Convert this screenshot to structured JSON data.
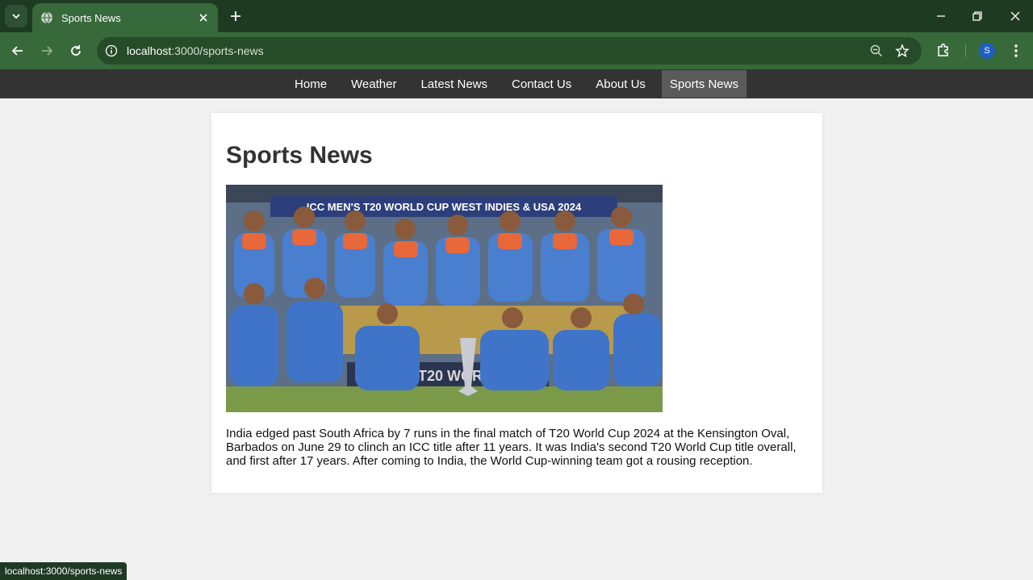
{
  "browser": {
    "tab_title": "Sports News",
    "url_host": "localhost",
    "url_path": ":3000/sports-news",
    "avatar_letter": "S",
    "status_url": "localhost:3000/sports-news",
    "colors": {
      "tabstrip": "#1f3a22",
      "toolbar": "#37693b",
      "omnibox": "#264b29"
    }
  },
  "nav": {
    "items": [
      {
        "label": "Home"
      },
      {
        "label": "Weather"
      },
      {
        "label": "Latest News"
      },
      {
        "label": "Contact Us"
      },
      {
        "label": "About Us"
      },
      {
        "label": "Sports News",
        "active": true
      }
    ]
  },
  "article": {
    "heading": "Sports News",
    "image_banner_text": "ICC MEN'S T20 WORLD CUP WEST INDIES & USA 2024",
    "image_floor_text": "T20 WORLD",
    "body": "India edged past South Africa by 7 runs in the final match of T20 World Cup 2024 at the Kensington Oval, Barbados on June 29 to clinch an ICC title after 11 years. It was India's second T20 World Cup title overall, and first after 17 years. After coming to India, the World Cup-winning team got a rousing reception."
  }
}
